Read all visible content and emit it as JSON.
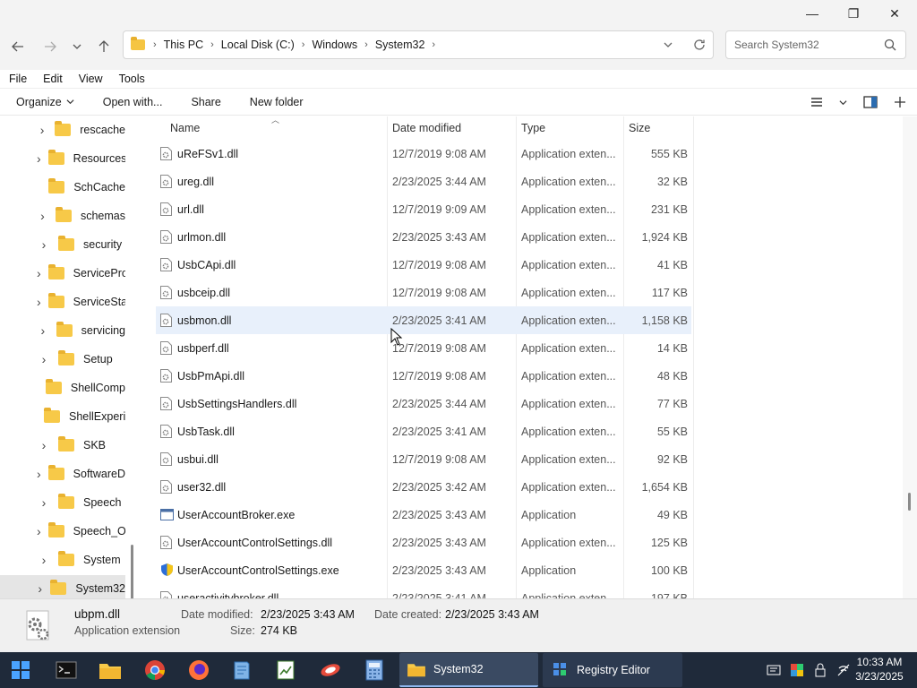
{
  "window": {
    "minimize_glyph": "—",
    "maximize_glyph": "❐",
    "close_glyph": "✕"
  },
  "address": {
    "breadcrumbs": [
      "This PC",
      "Local Disk (C:)",
      "Windows",
      "System32"
    ],
    "search_placeholder": "Search System32"
  },
  "menu": [
    "File",
    "Edit",
    "View",
    "Tools"
  ],
  "toolbar": {
    "organize": "Organize",
    "open_with": "Open with...",
    "share": "Share",
    "new_folder": "New folder"
  },
  "nav_tree": [
    {
      "label": "rescache",
      "expandable": true
    },
    {
      "label": "Resources",
      "expandable": true
    },
    {
      "label": "SchCache",
      "expandable": false
    },
    {
      "label": "schemas",
      "expandable": true
    },
    {
      "label": "security",
      "expandable": true
    },
    {
      "label": "ServiceProf",
      "expandable": true
    },
    {
      "label": "ServiceState",
      "expandable": true
    },
    {
      "label": "servicing",
      "expandable": true
    },
    {
      "label": "Setup",
      "expandable": true
    },
    {
      "label": "ShellComp",
      "expandable": false
    },
    {
      "label": "ShellExperie",
      "expandable": false
    },
    {
      "label": "SKB",
      "expandable": true
    },
    {
      "label": "SoftwareDis",
      "expandable": true
    },
    {
      "label": "Speech",
      "expandable": true
    },
    {
      "label": "Speech_One",
      "expandable": true
    },
    {
      "label": "System",
      "expandable": true
    },
    {
      "label": "System32",
      "expandable": true,
      "selected": true
    }
  ],
  "columns": {
    "name": "Name",
    "date": "Date modified",
    "type": "Type",
    "size": "Size"
  },
  "files": [
    {
      "name": "uReFSv1.dll",
      "date": "12/7/2019 9:08 AM",
      "type": "Application exten...",
      "size": "555 KB",
      "icon": "dll-icon"
    },
    {
      "name": "ureg.dll",
      "date": "2/23/2025 3:44 AM",
      "type": "Application exten...",
      "size": "32 KB",
      "icon": "dll-icon"
    },
    {
      "name": "url.dll",
      "date": "12/7/2019 9:09 AM",
      "type": "Application exten...",
      "size": "231 KB",
      "icon": "dll-icon"
    },
    {
      "name": "urlmon.dll",
      "date": "2/23/2025 3:43 AM",
      "type": "Application exten...",
      "size": "1,924 KB",
      "icon": "dll-icon"
    },
    {
      "name": "UsbCApi.dll",
      "date": "12/7/2019 9:08 AM",
      "type": "Application exten...",
      "size": "41 KB",
      "icon": "dll-icon"
    },
    {
      "name": "usbceip.dll",
      "date": "12/7/2019 9:08 AM",
      "type": "Application exten...",
      "size": "117 KB",
      "icon": "dll-icon"
    },
    {
      "name": "usbmon.dll",
      "date": "2/23/2025 3:41 AM",
      "type": "Application exten...",
      "size": "1,158 KB",
      "icon": "dll-icon",
      "hover": true
    },
    {
      "name": "usbperf.dll",
      "date": "12/7/2019 9:08 AM",
      "type": "Application exten...",
      "size": "14 KB",
      "icon": "dll-icon"
    },
    {
      "name": "UsbPmApi.dll",
      "date": "12/7/2019 9:08 AM",
      "type": "Application exten...",
      "size": "48 KB",
      "icon": "dll-icon"
    },
    {
      "name": "UsbSettingsHandlers.dll",
      "date": "2/23/2025 3:44 AM",
      "type": "Application exten...",
      "size": "77 KB",
      "icon": "dll-icon"
    },
    {
      "name": "UsbTask.dll",
      "date": "2/23/2025 3:41 AM",
      "type": "Application exten...",
      "size": "55 KB",
      "icon": "dll-icon"
    },
    {
      "name": "usbui.dll",
      "date": "12/7/2019 9:08 AM",
      "type": "Application exten...",
      "size": "92 KB",
      "icon": "dll-icon"
    },
    {
      "name": "user32.dll",
      "date": "2/23/2025 3:42 AM",
      "type": "Application exten...",
      "size": "1,654 KB",
      "icon": "dll-icon"
    },
    {
      "name": "UserAccountBroker.exe",
      "date": "2/23/2025 3:43 AM",
      "type": "Application",
      "size": "49 KB",
      "icon": "exe-icon"
    },
    {
      "name": "UserAccountControlSettings.dll",
      "date": "2/23/2025 3:43 AM",
      "type": "Application exten...",
      "size": "125 KB",
      "icon": "dll-icon"
    },
    {
      "name": "UserAccountControlSettings.exe",
      "date": "2/23/2025 3:43 AM",
      "type": "Application",
      "size": "100 KB",
      "icon": "shield-icon"
    },
    {
      "name": "useractivitybroker.dll",
      "date": "2/23/2025 3:41 AM",
      "type": "Application exten...",
      "size": "197 KB",
      "icon": "dll-icon"
    }
  ],
  "details": {
    "name": "ubpm.dll",
    "type": "Application extension",
    "date_modified_label": "Date modified:",
    "date_modified": "2/23/2025 3:43 AM",
    "date_created_label": "Date created:",
    "date_created": "2/23/2025 3:43 AM",
    "size_label": "Size:",
    "size": "274 KB"
  },
  "taskbar": {
    "apps": [
      {
        "label": "System32",
        "active": true
      },
      {
        "label": "Registry Editor",
        "active": false
      }
    ],
    "time": "10:33 AM",
    "date": "3/23/2025"
  },
  "colors": {
    "accent": "#0067c0",
    "hover_row": "#e8f0fb",
    "folder": "#f7c948",
    "taskbar": "#1f2a3a"
  }
}
